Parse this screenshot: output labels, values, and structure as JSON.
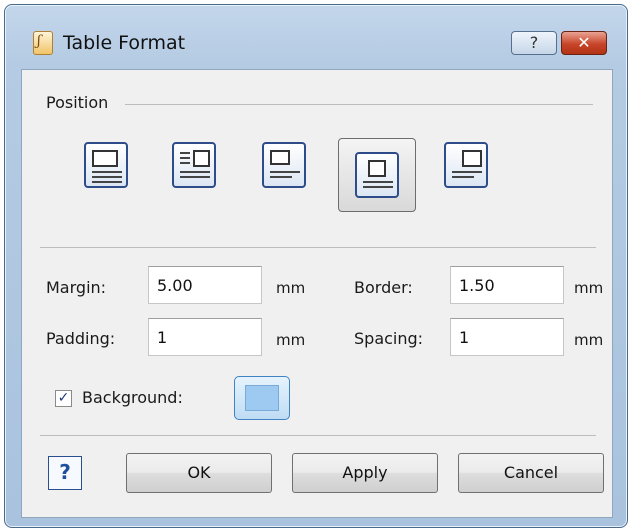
{
  "window": {
    "title": "Table Format",
    "help_button": "?",
    "close_button": "✕"
  },
  "position": {
    "label": "Position",
    "options": [
      {
        "name": "position-left"
      },
      {
        "name": "position-center-wrap"
      },
      {
        "name": "position-left-inline"
      },
      {
        "name": "position-center",
        "selected": true
      },
      {
        "name": "position-right"
      }
    ]
  },
  "fields": {
    "margin": {
      "label": "Margin:",
      "value": "5.00",
      "unit": "mm"
    },
    "border": {
      "label": "Border:",
      "value": "1.50",
      "unit": "mm"
    },
    "padding": {
      "label": "Padding:",
      "value": "1",
      "unit": "mm"
    },
    "spacing": {
      "label": "Spacing:",
      "value": "1",
      "unit": "mm"
    }
  },
  "background": {
    "label": "Background:",
    "checked": true,
    "check_glyph": "✓",
    "color": "#9ec9f0"
  },
  "buttons": {
    "help_glyph": "?",
    "ok": "OK",
    "apply": "Apply",
    "cancel": "Cancel"
  }
}
